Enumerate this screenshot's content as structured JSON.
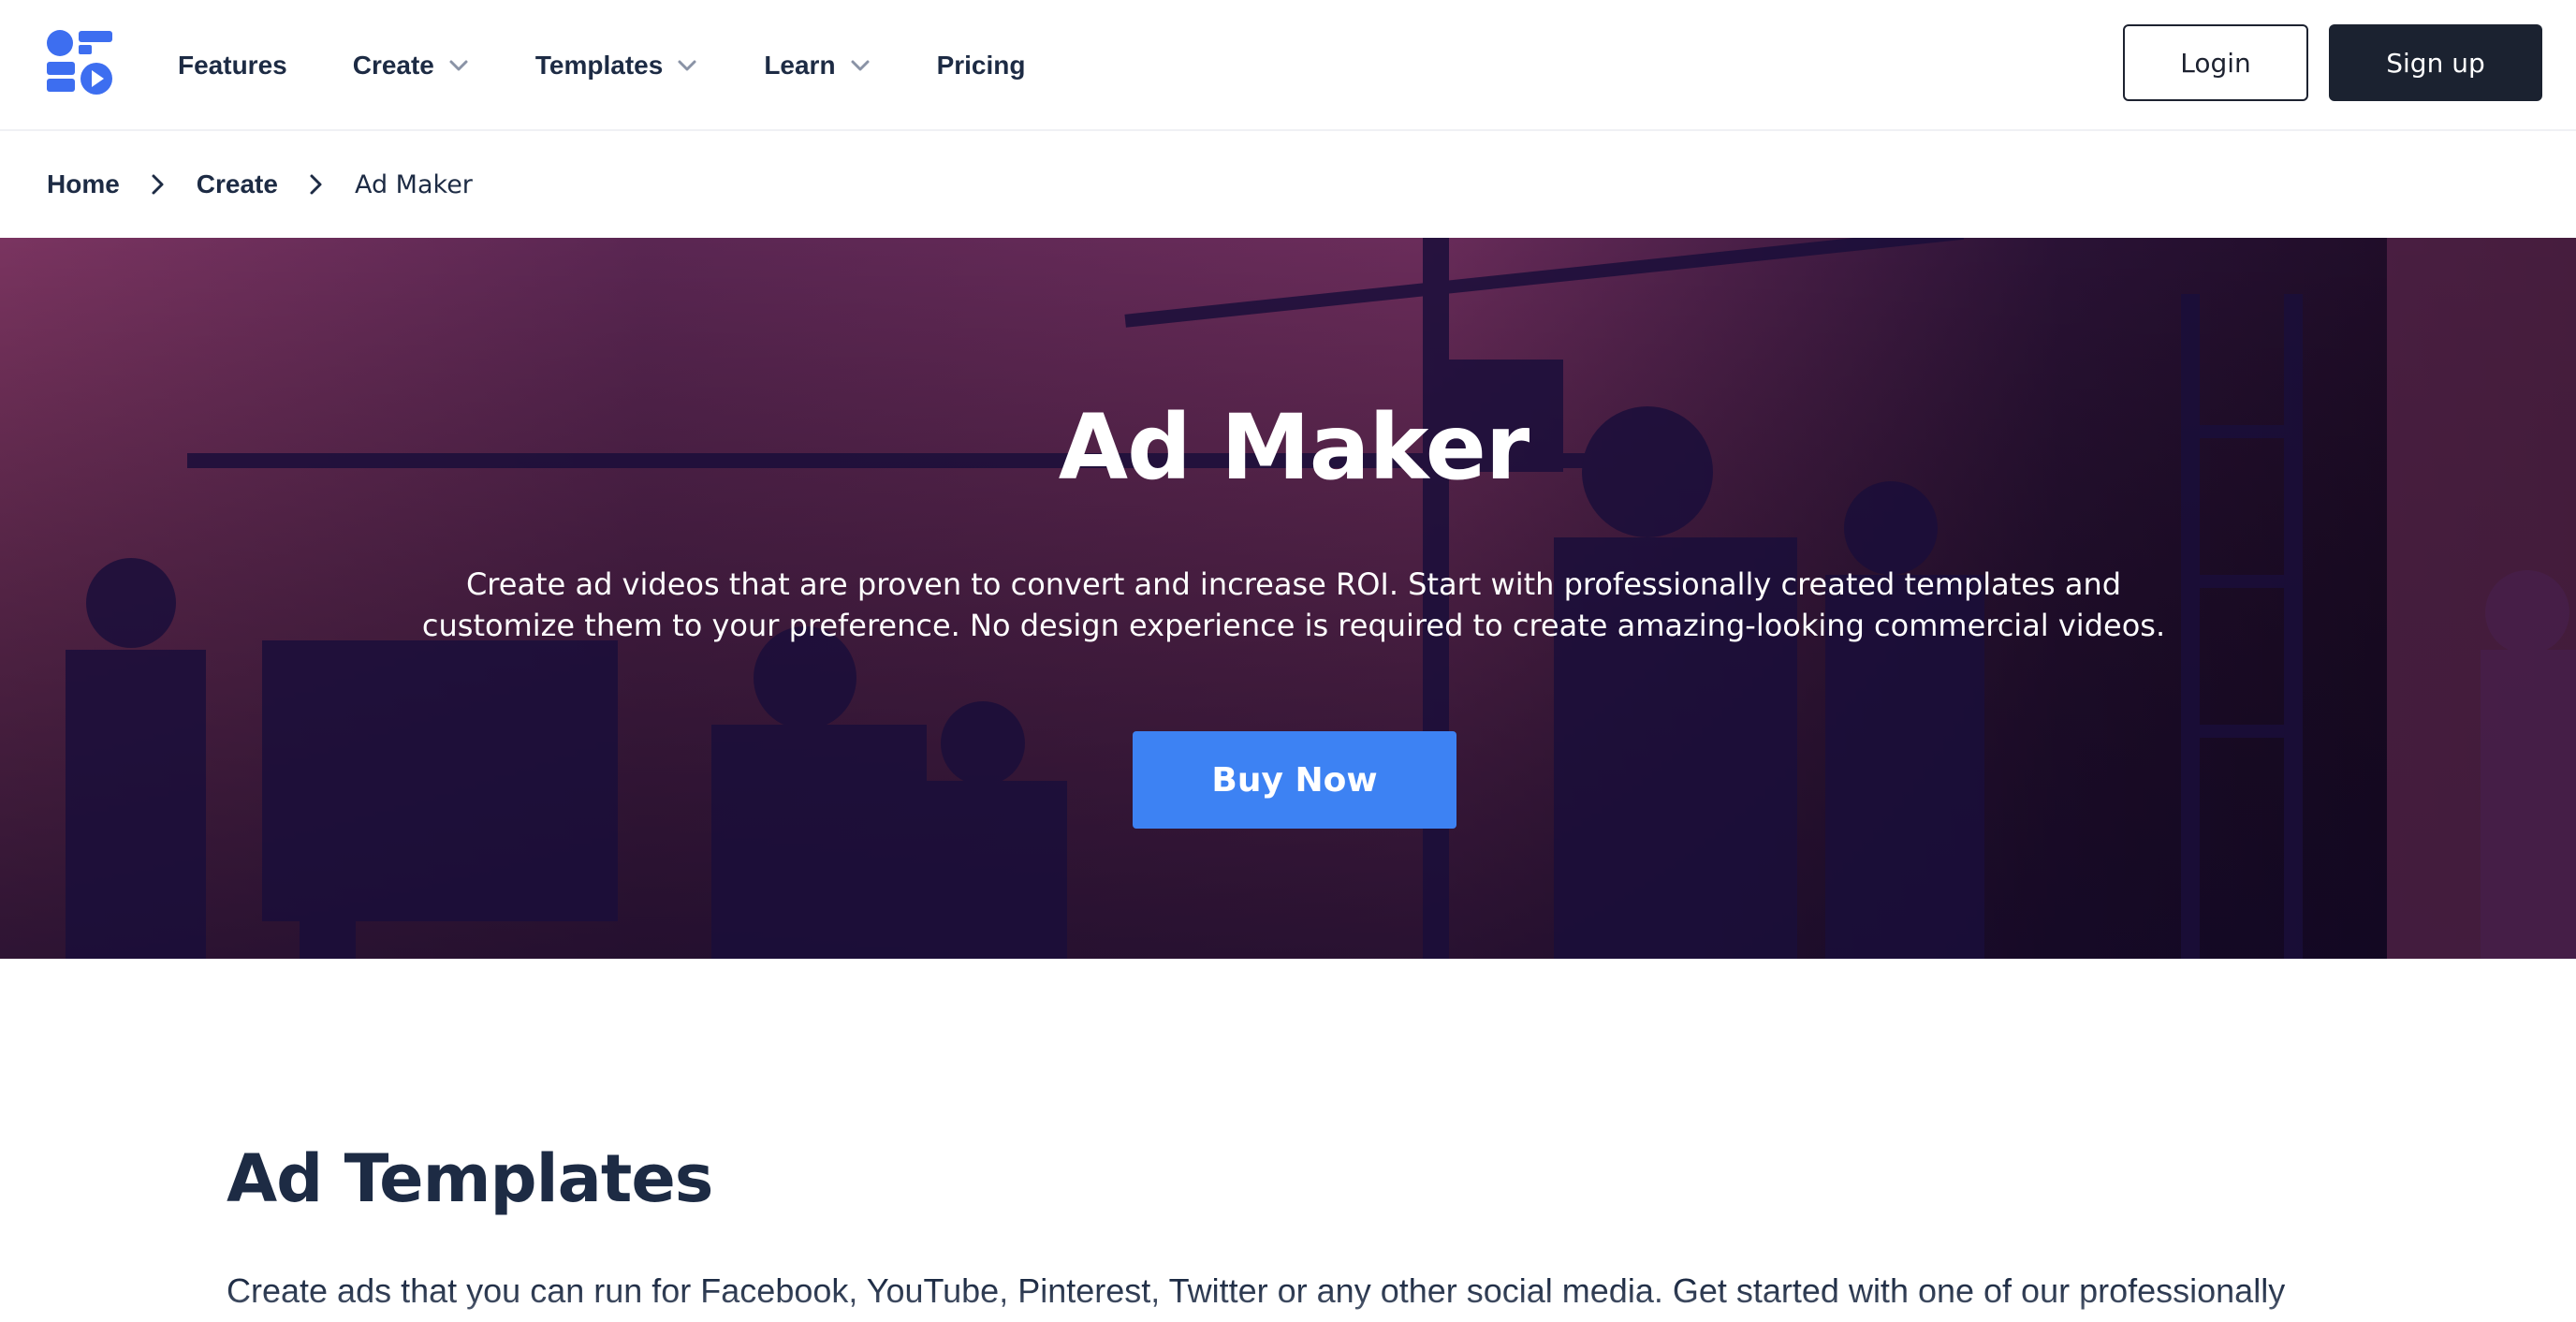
{
  "nav": {
    "items": [
      {
        "label": "Features",
        "has_dropdown": false
      },
      {
        "label": "Create",
        "has_dropdown": true
      },
      {
        "label": "Templates",
        "has_dropdown": true
      },
      {
        "label": "Learn",
        "has_dropdown": true
      },
      {
        "label": "Pricing",
        "has_dropdown": false
      }
    ],
    "login_label": "Login",
    "signup_label": "Sign up"
  },
  "breadcrumb": {
    "home": "Home",
    "create": "Create",
    "current": "Ad Maker"
  },
  "hero": {
    "title": "Ad Maker",
    "description": "Create ad videos that are proven to convert and increase ROI. Start with professionally created templates and customize them to your preference. No design experience is required to create amazing-looking commercial videos.",
    "buy_label": "Buy Now"
  },
  "templates_section": {
    "title": "Ad Templates",
    "text": "Create ads that you can run for Facebook, YouTube, Pinterest, Twitter or any other social media. Get started with one of our professionally"
  },
  "colors": {
    "brand": "#3d82f3",
    "text_dark": "#1d2b44",
    "signup_bg": "#1b2230",
    "hero_tint": "#6a2c55"
  },
  "icons": {
    "logo": "brand-logo-icon",
    "dropdown": "chevron-down-icon",
    "breadcrumb_separator": "chevron-right-icon"
  }
}
